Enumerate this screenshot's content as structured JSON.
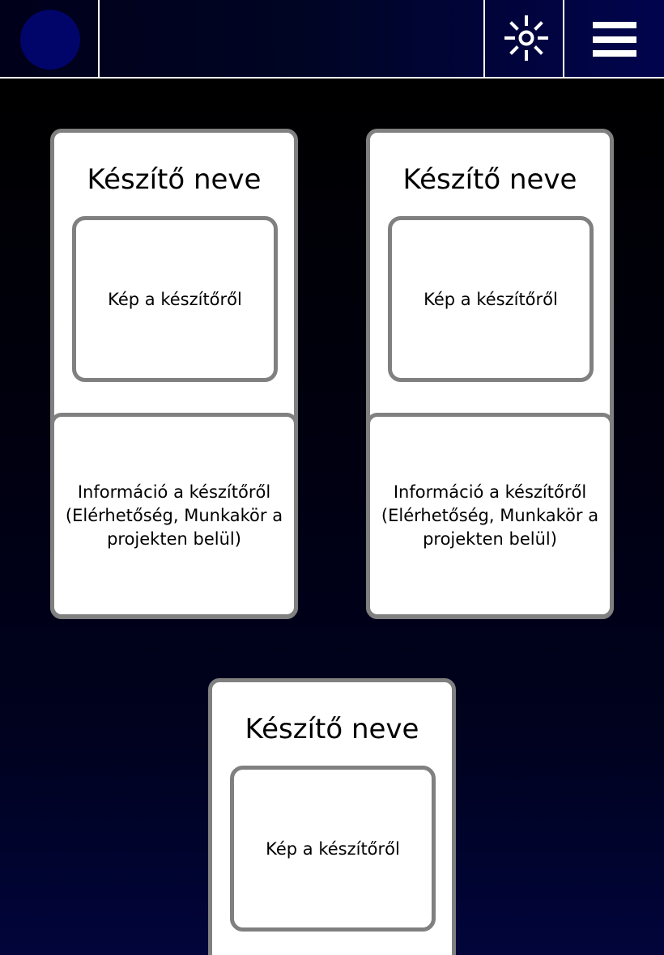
{
  "header": {
    "logo": "logo-circle",
    "theme_toggle_icon": "sun-icon",
    "menu_icon": "hamburger-menu-icon",
    "colors": {
      "header_gradient_end": "#01044d",
      "logo_fill": "#01056a"
    }
  },
  "cards": [
    {
      "name": "Készítő neve",
      "photo": "Kép a készítőről",
      "info": "Információ a készítőről (Elérhetőség, Munkakör a projekten belül)"
    },
    {
      "name": "Készítő neve",
      "photo": "Kép a készítőről",
      "info": "Információ a készítőről (Elérhetőség, Munkakör a projekten belül)"
    },
    {
      "name": "Készítő neve",
      "photo": "Kép a készítőről"
    }
  ],
  "colors": {
    "card_border": "#808080",
    "page_background_bottom": "#01053a"
  }
}
